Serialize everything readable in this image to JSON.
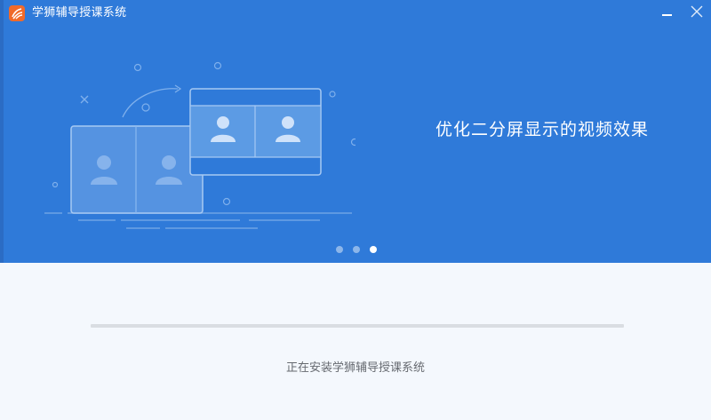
{
  "window": {
    "title": "学狮辅导授课系统",
    "minimize_icon": "minimize-icon",
    "close_icon": "close-icon"
  },
  "banner": {
    "slogan": "优化二分屏显示的视频效果",
    "carousel": {
      "count": 3,
      "active_index": 2
    }
  },
  "install": {
    "progress": 0,
    "status_text": "正在安装学狮辅导授课系统"
  },
  "colors": {
    "banner_bg": "#2f7ad9",
    "page_bg": "#f4f8fd",
    "progress_track": "#d9dde2",
    "logo": "#f06a2a"
  }
}
